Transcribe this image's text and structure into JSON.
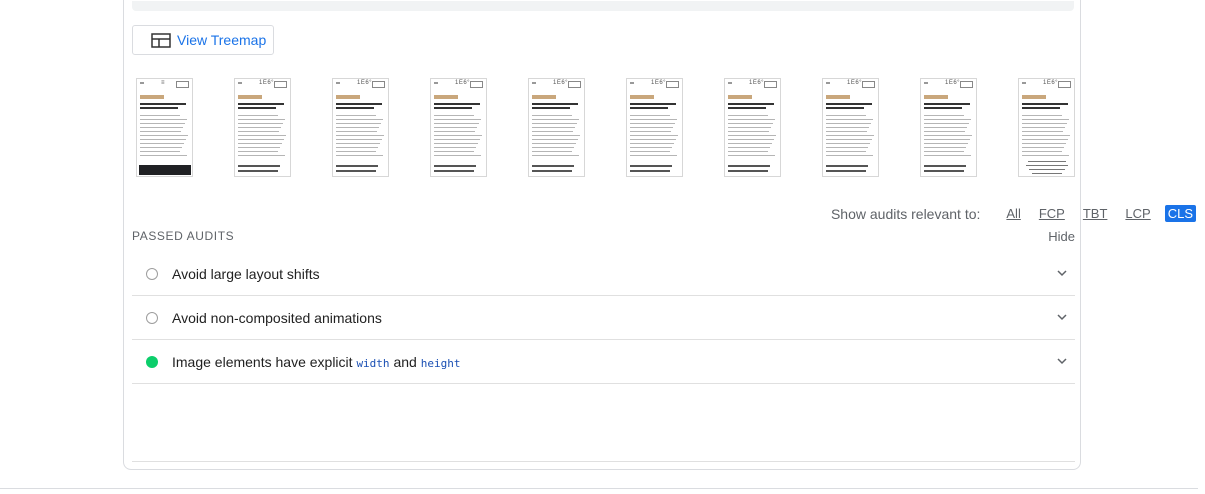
{
  "treemap": {
    "label": "View Treemap"
  },
  "filmstrip": {
    "frames": [
      {
        "logo": "≡",
        "variant": "loading"
      },
      {
        "logo": "1E6°",
        "variant": "loaded"
      },
      {
        "logo": "1E6°",
        "variant": "loaded"
      },
      {
        "logo": "1E6°",
        "variant": "loaded"
      },
      {
        "logo": "1E6°",
        "variant": "loaded"
      },
      {
        "logo": "1E6°",
        "variant": "loaded"
      },
      {
        "logo": "1E6°",
        "variant": "loaded"
      },
      {
        "logo": "1E6°",
        "variant": "loaded"
      },
      {
        "logo": "1E6°",
        "variant": "loaded"
      },
      {
        "logo": "1E6°",
        "variant": "final"
      }
    ]
  },
  "filters": {
    "prefix": "Show audits relevant to:",
    "options": [
      "All",
      "FCP",
      "TBT",
      "LCP",
      "CLS"
    ],
    "active": "CLS"
  },
  "passed_audits": {
    "title": "PASSED AUDITS",
    "toggle_label": "Hide",
    "items": [
      {
        "status": "na",
        "title": "Avoid large layout shifts"
      },
      {
        "status": "na",
        "title": "Avoid non-composited animations"
      },
      {
        "status": "pass",
        "title_prefix": "Image elements have explicit ",
        "code1": "width",
        "mid": " and ",
        "code2": "height"
      }
    ]
  },
  "colors": {
    "accent": "#1a73e8",
    "pass": "#0cce6b",
    "na": "#9e9e9e"
  }
}
